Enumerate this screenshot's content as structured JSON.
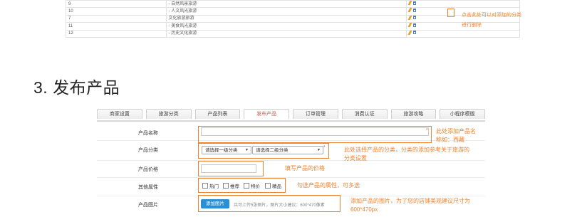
{
  "category_table": {
    "rows": [
      {
        "id": "9",
        "name": "- 自然风景旅游"
      },
      {
        "id": "10",
        "name": "- 人文风光旅游"
      },
      {
        "id": "7",
        "name": "文化旅游旅游"
      },
      {
        "id": "11",
        "name": "- 美食风光旅游"
      },
      {
        "id": "12",
        "name": "- 历史文化旅游"
      }
    ],
    "annotation_line1": "点击此处可以对添加的分类",
    "annotation_line2": "进行删除"
  },
  "section": {
    "title": "3. 发布产品"
  },
  "tabs": [
    {
      "label": "商家设置"
    },
    {
      "label": "旅游分类"
    },
    {
      "label": "产品列表"
    },
    {
      "label": "发布产品",
      "active": true
    },
    {
      "label": "订单管理"
    },
    {
      "label": "消费认证"
    },
    {
      "label": "旅游攻略"
    },
    {
      "label": "小程序模版"
    }
  ],
  "form": {
    "name_label": "产品名称",
    "name_value": "",
    "required_mark": "*",
    "category_label": "产品分类",
    "select_level1": "请选择一级分类",
    "select_level2": "请选择二级分类",
    "price_label": "产品价格",
    "price_value": "",
    "attr_label": "其他属性",
    "attr_options": [
      "热门",
      "推荐",
      "特价",
      "精品"
    ],
    "image_label": "产品图片",
    "upload_button": "添加图片",
    "upload_hint": "共可上传5张图片，图片大小建议：600*470像素"
  },
  "annotations": {
    "name_line1": "此处添加产品名",
    "name_line2": "称如：西藏",
    "category_line1": "此处选择产品的分类，分类的添加参考关于旅游的",
    "category_line2": "分类设置",
    "price": "填写产品的价格",
    "attr": "勾选产品的属性，可多选",
    "image_line1": "添加产品的图片，为了您的店铺美观建议尺寸为",
    "image_line2": "600*470px"
  },
  "colors": {
    "annotation": "#f0822c",
    "active_tab": "#d9534f",
    "upload_button": "#2b8fd6"
  }
}
